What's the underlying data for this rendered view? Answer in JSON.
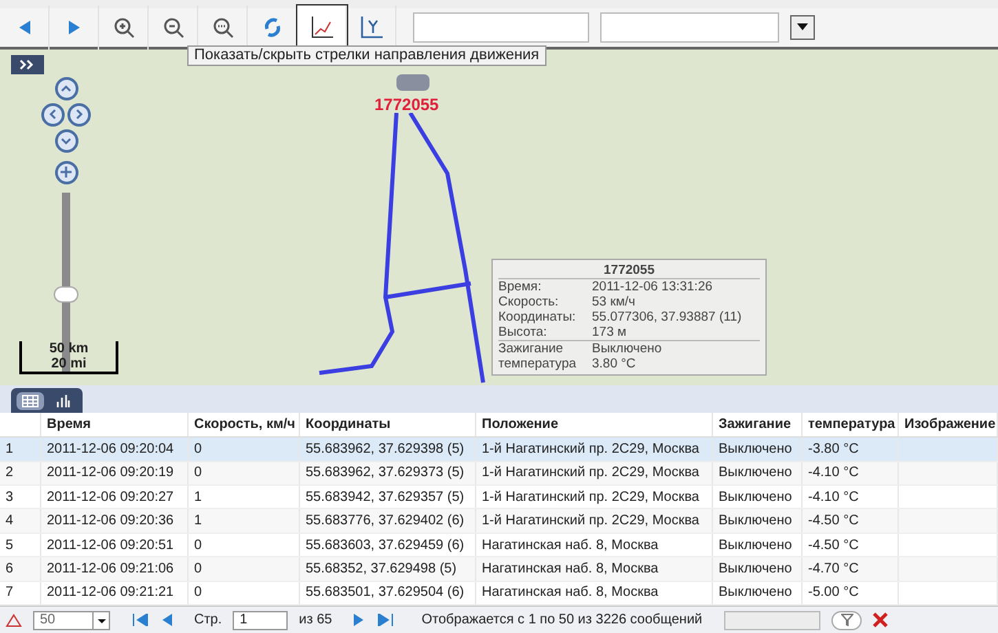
{
  "toolbar": {
    "tooltip": "Показать/скрыть стрелки направления движения"
  },
  "map": {
    "zoom": {
      "level": 0.42
    },
    "vehicle_label": "1772055",
    "scale": {
      "km": "50 km",
      "mi": "20 mi"
    },
    "popup": {
      "title": "1772055",
      "rows": [
        {
          "label": "Время:",
          "value": "2011-12-06 13:31:26"
        },
        {
          "label": "Скорость:",
          "value": "53 км/ч"
        },
        {
          "label": "Координаты:",
          "value": "55.077306, 37.93887 (11)"
        },
        {
          "label": "Высота:",
          "value": "173 м"
        },
        {
          "label": "Зажигание",
          "value": "Выключено"
        },
        {
          "label": "температура",
          "value": "3.80 °C"
        }
      ]
    }
  },
  "view_tabs": [
    {
      "kind": "table",
      "selected": true
    },
    {
      "kind": "chart",
      "selected": false
    }
  ],
  "table": {
    "columns": [
      "",
      "Время",
      "Скорость, км/ч",
      "Координаты",
      "Положение",
      "Зажигание",
      "температура",
      "Изображение"
    ],
    "rows": [
      {
        "selected": true,
        "cells": [
          "1",
          "2011-12-06 09:20:04",
          "0",
          "55.683962, 37.629398 (5)",
          "1-й Нагатинский пр. 2С29, Москва",
          "Выключено",
          "-3.80 °C",
          ""
        ]
      },
      {
        "selected": false,
        "cells": [
          "2",
          "2011-12-06 09:20:19",
          "0",
          "55.683962, 37.629373 (5)",
          "1-й Нагатинский пр. 2С29, Москва",
          "Выключено",
          "-4.10 °C",
          ""
        ]
      },
      {
        "selected": false,
        "cells": [
          "3",
          "2011-12-06 09:20:27",
          "1",
          "55.683942, 37.629357 (5)",
          "1-й Нагатинский пр. 2С29, Москва",
          "Выключено",
          "-4.10 °C",
          ""
        ]
      },
      {
        "selected": false,
        "cells": [
          "4",
          "2011-12-06 09:20:36",
          "1",
          "55.683776, 37.629402 (6)",
          "1-й Нагатинский пр. 2С29, Москва",
          "Выключено",
          "-4.50 °C",
          ""
        ]
      },
      {
        "selected": false,
        "cells": [
          "5",
          "2011-12-06 09:20:51",
          "0",
          "55.683603, 37.629459 (6)",
          "Нагатинская наб. 8, Москва",
          "Выключено",
          "-4.50 °C",
          ""
        ]
      },
      {
        "selected": false,
        "cells": [
          "6",
          "2011-12-06 09:21:06",
          "0",
          "55.68352, 37.629498 (5)",
          "Нагатинская наб. 8, Москва",
          "Выключено",
          "-4.70 °C",
          ""
        ]
      },
      {
        "selected": false,
        "cells": [
          "7",
          "2011-12-06 09:21:21",
          "0",
          "55.683501, 37.629504 (6)",
          "Нагатинская наб. 8, Москва",
          "Выключено",
          "-5.00 °C",
          ""
        ]
      }
    ]
  },
  "pager": {
    "page_size": "50",
    "page_label": "Стр.",
    "page": "1",
    "of_pages": "из 65",
    "status": "Отображается с 1 по 50 из 3226 сообщений"
  }
}
